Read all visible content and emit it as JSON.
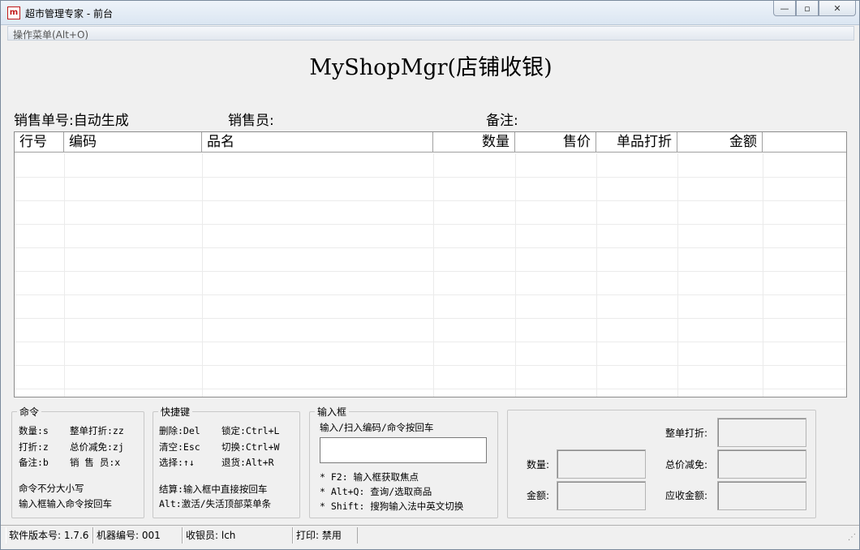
{
  "window": {
    "title": "超市管理专家 - 前台",
    "icon_glyph": "m",
    "minimize": "—",
    "maximize": "▫",
    "close": "✕"
  },
  "menu": {
    "operations": "操作菜单(Alt+O)"
  },
  "header": {
    "title": "MyShopMgr(店铺收银)"
  },
  "info": {
    "order_no": "销售单号:自动生成",
    "salesperson": "销售员:",
    "remark": "备注:"
  },
  "table": {
    "columns": [
      "行号",
      "编码",
      "品名",
      "数量",
      "售价",
      "单品打折",
      "金额",
      ""
    ],
    "rows": []
  },
  "commands": {
    "legend": "命令",
    "items": [
      "数量:s",
      "整单打折:zz",
      "打折:z",
      "总价减免:zj",
      "备注:b",
      "销 售 员:x"
    ],
    "note1": "命令不分大小写",
    "note2": "输入框输入命令按回车"
  },
  "shortcuts": {
    "legend": "快捷键",
    "items": [
      "删除:Del",
      "锁定:Ctrl+L",
      "清空:Esc",
      "切换:Ctrl+W",
      "选择:↑↓",
      "退货:Alt+R"
    ],
    "note1": "结算:输入框中直接按回车",
    "note2": "Alt:激活/失活顶部菜单条"
  },
  "inputbox": {
    "legend": "输入框",
    "hint": "输入/扫入编码/命令按回车",
    "value": "",
    "tip1": "* F2: 输入框获取焦点",
    "tip2": "* Alt+Q: 查询/选取商品",
    "tip3": "* Shift: 搜狗输入法中英文切换"
  },
  "summary": {
    "quantity_label": "数量:",
    "amount_label": "金额:",
    "order_discount_label": "整单打折:",
    "total_reduce_label": "总价减免:",
    "receivable_label": "应收金额:"
  },
  "status": {
    "version": "软件版本号: 1.7.6",
    "machine": "机器编号: 001",
    "cashier": "收银员: lch",
    "print": "打印: 禁用"
  }
}
